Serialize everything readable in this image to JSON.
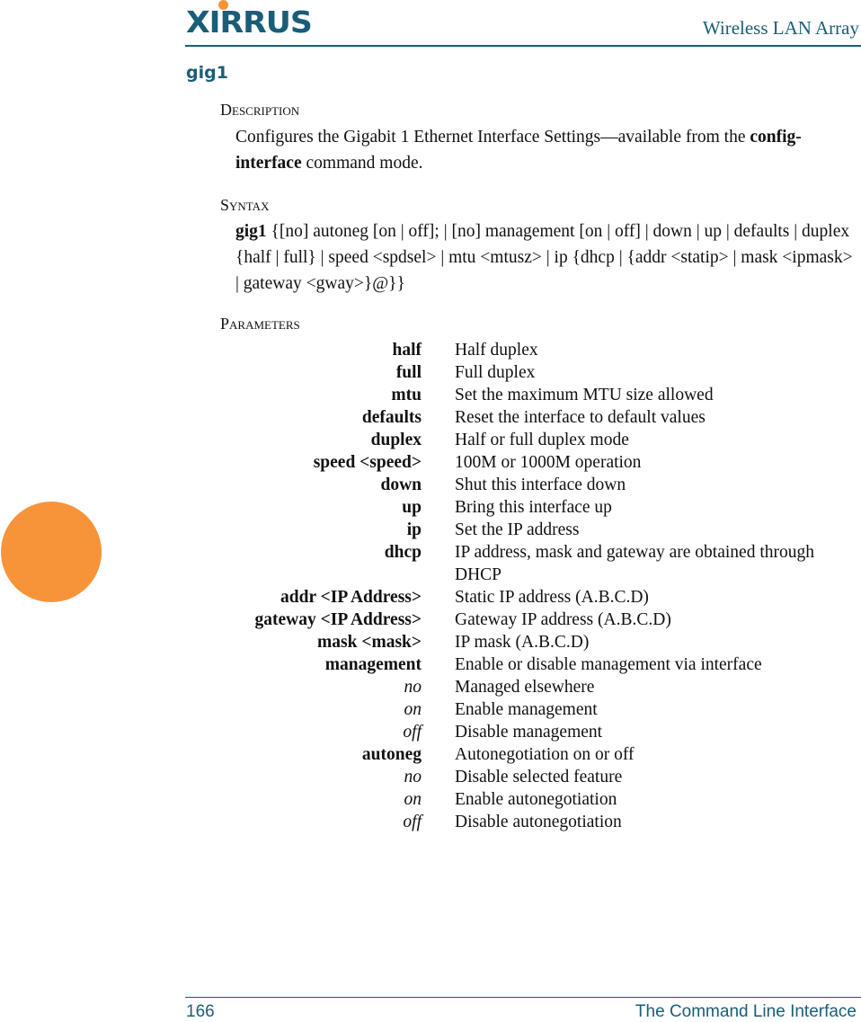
{
  "header": {
    "logo_text": "XIRRUS",
    "title": "Wireless LAN Array"
  },
  "command": {
    "name": "gig1"
  },
  "description": {
    "heading": "Description",
    "text_before": "Configures the Gigabit 1 Ethernet Interface Settings—available from the ",
    "bold_term": "config-interface",
    "text_after": " command mode."
  },
  "syntax": {
    "heading": "Syntax",
    "command": "gig1",
    "text": " {[no] autoneg [on | off]; | [no] management [on | off] | down | up | defaults | duplex {half | full} | speed <spdsel> | mtu <mtusz> | ip {dhcp | {addr <statip> | mask <ipmask> | gateway <gway>}@}}"
  },
  "parameters": {
    "heading": "Parameters",
    "rows": [
      {
        "name": "half",
        "desc": "Half duplex",
        "italic": false
      },
      {
        "name": "full",
        "desc": "Full duplex",
        "italic": false
      },
      {
        "name": "mtu",
        "desc": "Set the maximum MTU size allowed",
        "italic": false
      },
      {
        "name": "defaults",
        "desc": "Reset the interface to default values",
        "italic": false
      },
      {
        "name": "duplex",
        "desc": "Half or full duplex mode",
        "italic": false
      },
      {
        "name": "speed <speed>",
        "desc": "100M or 1000M operation",
        "italic": false
      },
      {
        "name": "down",
        "desc": "Shut this interface down",
        "italic": false
      },
      {
        "name": "up",
        "desc": "Bring this interface up",
        "italic": false
      },
      {
        "name": "ip",
        "desc": "Set the IP address",
        "italic": false
      },
      {
        "name": "dhcp",
        "desc": "IP address, mask and gateway are obtained through DHCP",
        "italic": false
      },
      {
        "name": "addr <IP Address>",
        "desc": "Static IP address (A.B.C.D)",
        "italic": false
      },
      {
        "name": "gateway <IP Address>",
        "desc": "Gateway IP address (A.B.C.D)",
        "italic": false
      },
      {
        "name": "mask <mask>",
        "desc": "IP mask (A.B.C.D)",
        "italic": false
      },
      {
        "name": "management",
        "desc": "Enable or disable management via interface",
        "italic": false
      },
      {
        "name": "no",
        "desc": "Managed elsewhere",
        "italic": true
      },
      {
        "name": "on",
        "desc": "Enable management",
        "italic": true
      },
      {
        "name": "off",
        "desc": "Disable management",
        "italic": true
      },
      {
        "name": "autoneg",
        "desc": "Autonegotiation on or off",
        "italic": false
      },
      {
        "name": "no",
        "desc": "Disable selected feature",
        "italic": true
      },
      {
        "name": "on",
        "desc": "Enable autonegotiation",
        "italic": true
      },
      {
        "name": "off",
        "desc": "Disable autonegotiation",
        "italic": true
      }
    ]
  },
  "footer": {
    "page_number": "166",
    "section": "The Command Line Interface"
  },
  "colors": {
    "brand_teal": "#1a5d78",
    "brand_orange": "#f7943a"
  }
}
